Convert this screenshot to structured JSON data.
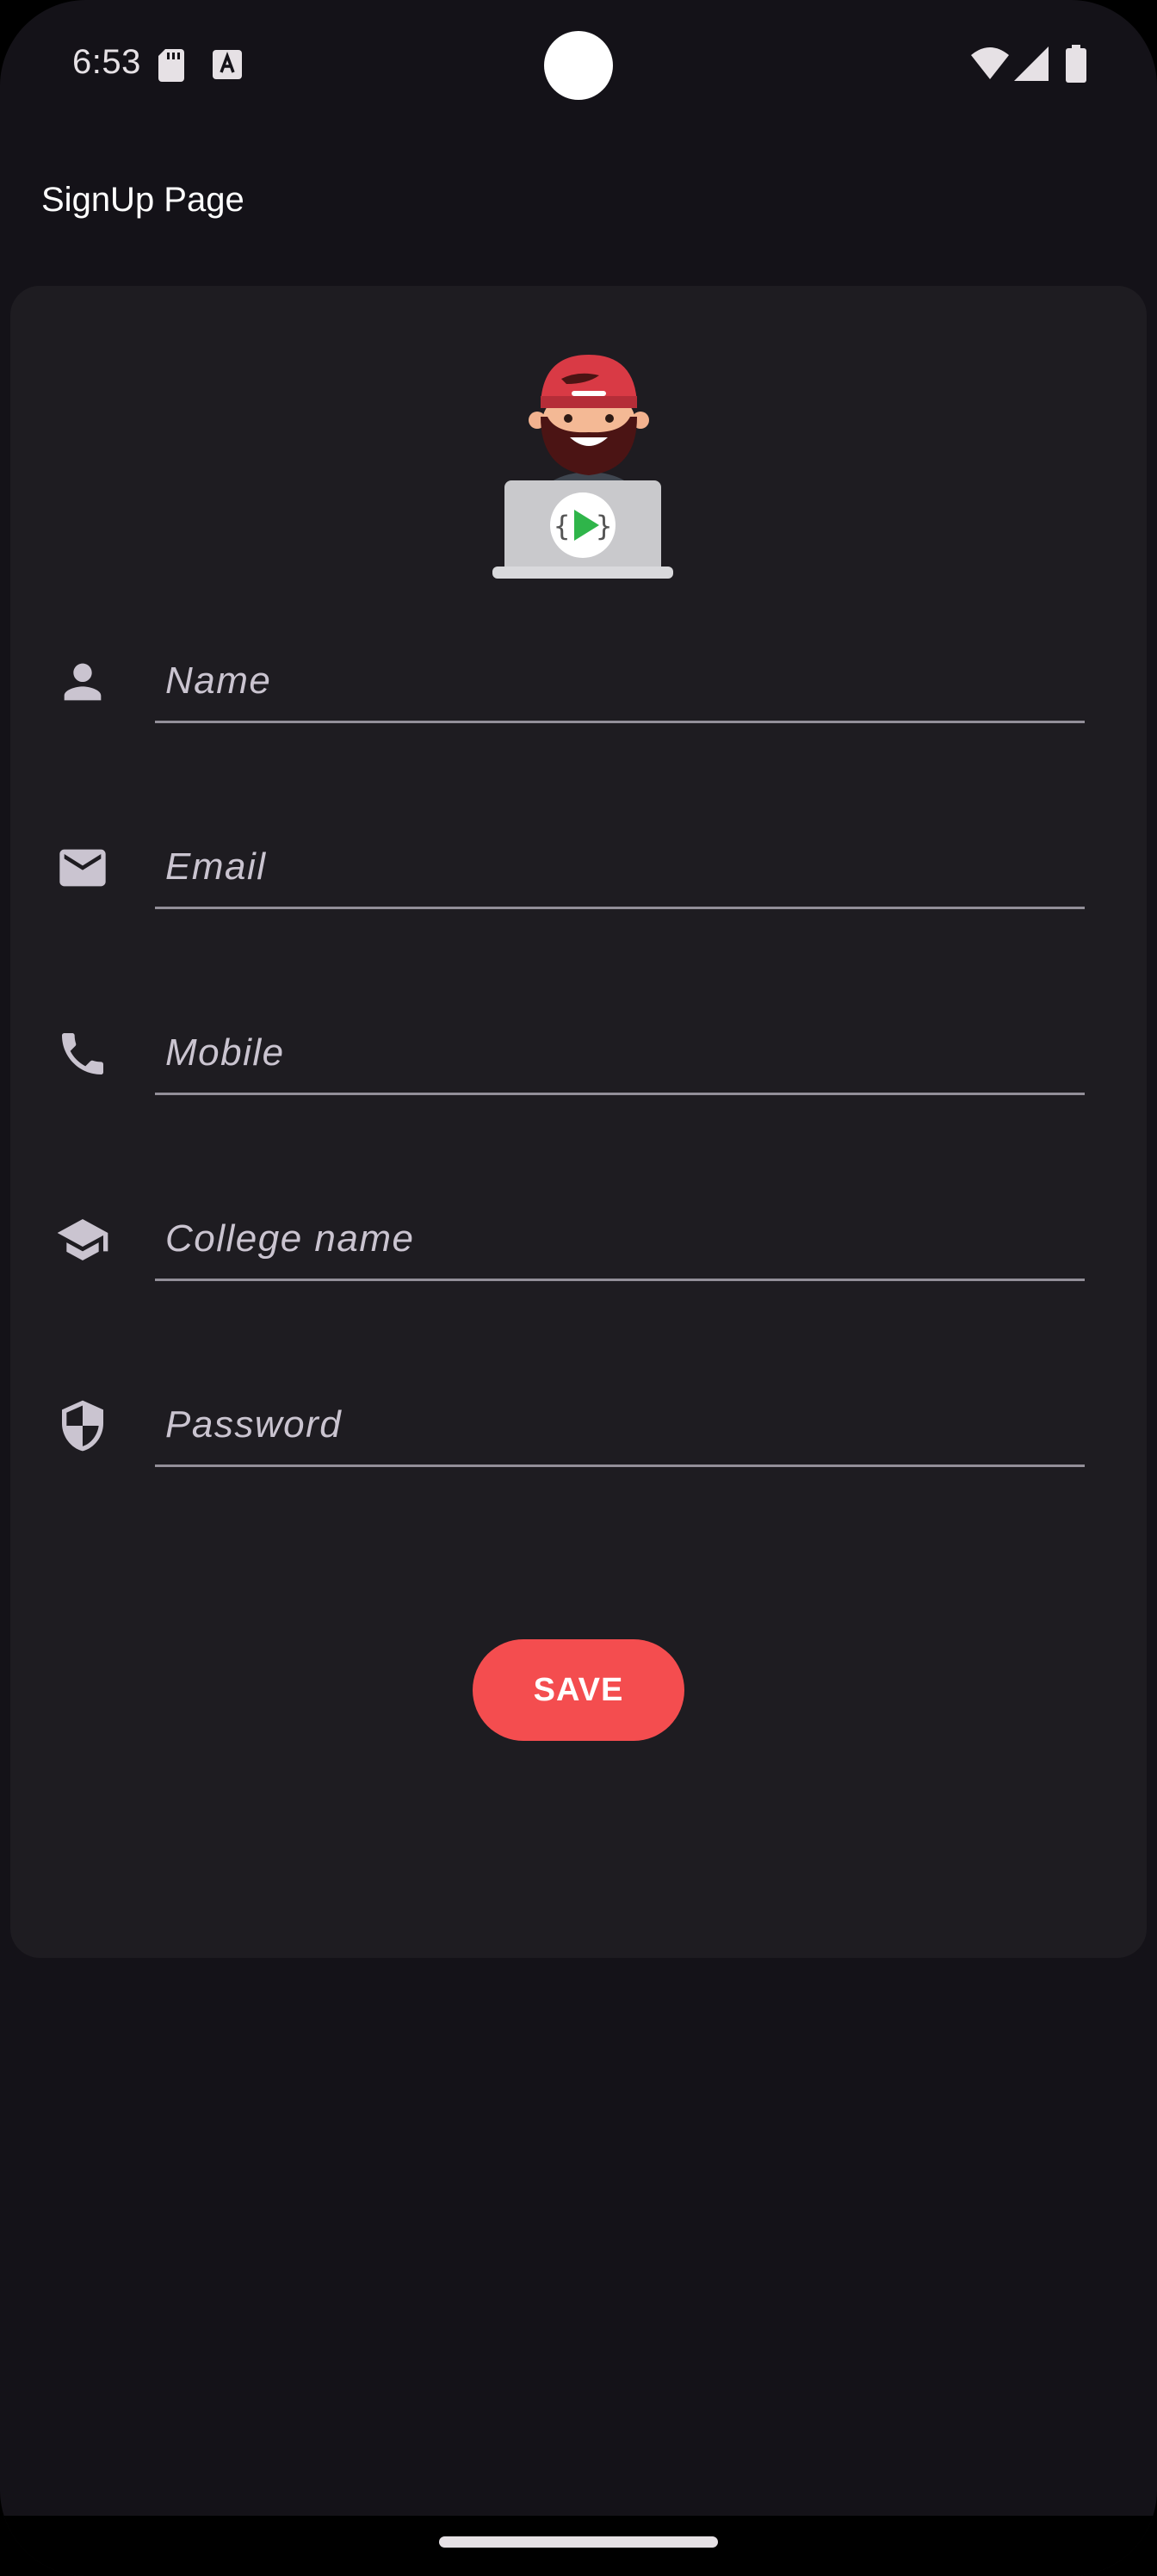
{
  "status_bar": {
    "time": "6:53",
    "icons": [
      "sd-card-icon",
      "a-notification-icon",
      "wifi-icon",
      "signal-icon",
      "battery-icon"
    ]
  },
  "app_bar": {
    "title": "SignUp Page"
  },
  "form": {
    "avatar_icon": "developer-avatar-icon",
    "fields": [
      {
        "placeholder": "Name",
        "value": "",
        "icon": "person-icon"
      },
      {
        "placeholder": "Email",
        "value": "",
        "icon": "email-icon"
      },
      {
        "placeholder": "Mobile",
        "value": "",
        "icon": "phone-icon"
      },
      {
        "placeholder": "College name",
        "value": "",
        "icon": "school-icon"
      },
      {
        "placeholder": "Password",
        "value": "",
        "icon": "shield-icon"
      }
    ],
    "save_label": "SAVE"
  },
  "colors": {
    "background": "#141218",
    "card": "#1e1c21",
    "accent": "#f44d4f",
    "icon": "#cac4d0",
    "underline": "#938f99"
  }
}
